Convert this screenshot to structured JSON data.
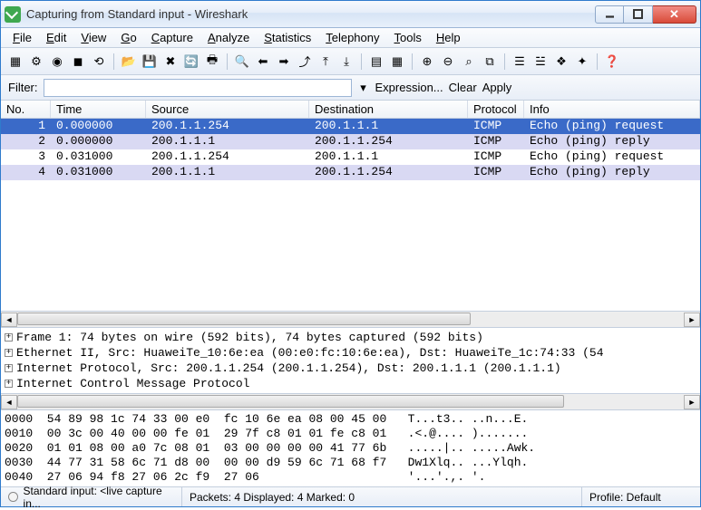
{
  "window": {
    "title": "Capturing from Standard input - Wireshark"
  },
  "menu": {
    "items": [
      "File",
      "Edit",
      "View",
      "Go",
      "Capture",
      "Analyze",
      "Statistics",
      "Telephony",
      "Tools",
      "Help"
    ]
  },
  "toolbar_icons": [
    "interfaces-icon",
    "options-icon",
    "start-capture-icon",
    "stop-capture-icon",
    "restart-capture-icon",
    "sep",
    "open-file-icon",
    "save-file-icon",
    "close-file-icon",
    "reload-icon",
    "print-icon",
    "sep",
    "find-icon",
    "go-back-icon",
    "go-forward-icon",
    "go-to-icon",
    "go-first-icon",
    "go-last-icon",
    "sep",
    "colorize-icon",
    "auto-scroll-icon",
    "sep",
    "zoom-in-icon",
    "zoom-out-icon",
    "zoom-reset-icon",
    "resize-cols-icon",
    "sep",
    "capture-filters-icon",
    "display-filters-icon",
    "coloring-rules-icon",
    "prefs-icon",
    "sep",
    "help-icon"
  ],
  "filter": {
    "label": "Filter:",
    "value": "",
    "expression": "Expression...",
    "clear": "Clear",
    "apply": "Apply"
  },
  "columns": [
    "No.",
    "Time",
    "Source",
    "Destination",
    "Protocol",
    "Info"
  ],
  "packets": [
    {
      "no": "1",
      "time": "0.000000",
      "src": "200.1.1.254",
      "dst": "200.1.1.1",
      "proto": "ICMP",
      "info": "Echo (ping) request",
      "sel": true
    },
    {
      "no": "2",
      "time": "0.000000",
      "src": "200.1.1.1",
      "dst": "200.1.1.254",
      "proto": "ICMP",
      "info": "Echo (ping) reply",
      "alt": true
    },
    {
      "no": "3",
      "time": "0.031000",
      "src": "200.1.1.254",
      "dst": "200.1.1.1",
      "proto": "ICMP",
      "info": "Echo (ping) request"
    },
    {
      "no": "4",
      "time": "0.031000",
      "src": "200.1.1.1",
      "dst": "200.1.1.254",
      "proto": "ICMP",
      "info": "Echo (ping) reply",
      "alt": true
    }
  ],
  "details": [
    "Frame 1: 74 bytes on wire (592 bits), 74 bytes captured (592 bits)",
    "Ethernet II, Src: HuaweiTe_10:6e:ea (00:e0:fc:10:6e:ea), Dst: HuaweiTe_1c:74:33 (54",
    "Internet Protocol, Src: 200.1.1.254 (200.1.1.254), Dst: 200.1.1.1 (200.1.1.1)",
    "Internet Control Message Protocol"
  ],
  "hex": [
    {
      "off": "0000",
      "b": "54 89 98 1c 74 33 00 e0  fc 10 6e ea 08 00 45 00",
      "a": "T...t3.. ..n...E."
    },
    {
      "off": "0010",
      "b": "00 3c 00 40 00 00 fe 01  29 7f c8 01 01 fe c8 01",
      "a": ".<.@.... )......."
    },
    {
      "off": "0020",
      "b": "01 01 08 00 a0 7c 08 01  03 00 00 00 00 41 77 6b",
      "a": ".....|.. .....Awk."
    },
    {
      "off": "0030",
      "b": "44 77 31 58 6c 71 d8 00  00 00 d9 59 6c 71 68 f7",
      "a": "Dw1Xlq.. ...Ylqh."
    },
    {
      "off": "0040",
      "b": "27 06 94 f8 27 06 2c f9  27 06                  ",
      "a": "'...'.,. '."
    }
  ],
  "status": {
    "source": "Standard input: <live capture in...",
    "counts": "Packets: 4 Displayed: 4 Marked: 0",
    "profile": "Profile: Default"
  }
}
